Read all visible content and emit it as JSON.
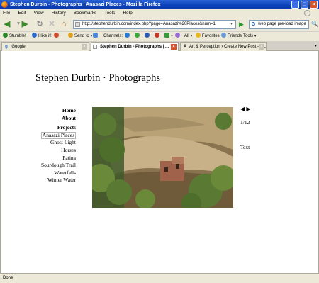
{
  "window": {
    "title": "Stephen Durbin - Photographs | Anasazi Places - Mozilla Firefox"
  },
  "menu": [
    "File",
    "Edit",
    "View",
    "History",
    "Bookmarks",
    "Tools",
    "Help"
  ],
  "nav": {
    "url": "http://stephendurbin.com/index.php?page=Anasazi%20Places&num=1",
    "search": "web page pre-load image"
  },
  "toolbar": {
    "stumble": "Stumble!",
    "like": "I like it!",
    "send": "Send to",
    "channels": "Channels:",
    "all": "All",
    "favorites": "Favorites",
    "friends": "Friends",
    "tools": "Tools"
  },
  "tabs": [
    {
      "label": "iGoogle"
    },
    {
      "label": "Stephen Durbin - Photographs | ..."
    },
    {
      "label": "Art & Perception › Create New Post — ..."
    }
  ],
  "page": {
    "site_title": "Stephen Durbin · Photographs",
    "nav_links": [
      "Home",
      "About"
    ],
    "projects_heading": "Projects",
    "projects": [
      "Anasazi Places",
      "Ghost Light",
      "Horses",
      "Patina",
      "Sourdough Trail",
      "Waterfalls",
      "Winter Water"
    ],
    "selected_project": "Anasazi Places",
    "counter": "1/12",
    "text_link": "Text"
  },
  "status": {
    "text": "Done"
  }
}
